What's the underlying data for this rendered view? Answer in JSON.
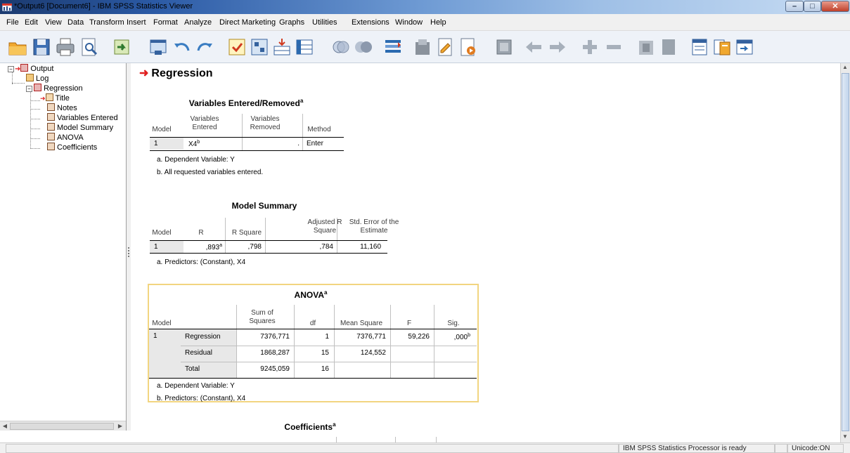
{
  "window": {
    "title": "*Output6 [Document6] - IBM SPSS Statistics Viewer"
  },
  "menu": [
    "File",
    "Edit",
    "View",
    "Data",
    "Transform",
    "Insert",
    "Format",
    "Analyze",
    "Direct Marketing",
    "Graphs",
    "Utilities",
    "Extensions",
    "Window",
    "Help"
  ],
  "toolbar_icons": [
    "open-icon",
    "save-icon",
    "print-icon",
    "print-preview-icon",
    "export-icon",
    "recall-dialog-icon",
    "undo-icon",
    "redo-icon",
    "goto-case-icon",
    "goto-variable-icon",
    "variables-icon",
    "insert-cases-icon",
    "value-labels-icon",
    "use-sets-icon",
    "split-file-icon",
    "select-cases-icon",
    "insert-output-icon",
    "insert-text-icon",
    "insert-title-icon",
    "designate-window-icon",
    "back-icon",
    "forward-icon",
    "expand-icon",
    "collapse-icon",
    "show-icon",
    "hide-icon",
    "insert-heading-icon",
    "insert-page-title-icon",
    "insert-new-text-icon"
  ],
  "outline": {
    "root": "Output",
    "log": "Log",
    "regression": "Regression",
    "items": [
      "Title",
      "Notes",
      "Variables Entered",
      "Model Summary",
      "ANOVA",
      "Coefficients"
    ]
  },
  "content": {
    "section_title": "Regression",
    "ver": {
      "title": "Variables Entered/Removed",
      "title_sup": "a",
      "headers": [
        "Model",
        "Variables Entered",
        "Variables Removed",
        "Method"
      ],
      "row": {
        "model": "1",
        "entered": "X4",
        "entered_sup": "b",
        "removed": ".",
        "method": "Enter"
      },
      "footnotes": [
        "a. Dependent Variable: Y",
        "b. All requested variables entered."
      ]
    },
    "model_summary": {
      "title": "Model Summary",
      "headers": [
        "Model",
        "R",
        "R Square",
        "Adjusted R Square",
        "Std. Error of the Estimate"
      ],
      "row": {
        "model": "1",
        "r": ",893",
        "r_sup": "a",
        "r_square": ",798",
        "adj_r_square": ",784",
        "std_error": "11,160"
      },
      "footnotes": [
        "a. Predictors: (Constant), X4"
      ]
    },
    "anova": {
      "title": "ANOVA",
      "title_sup": "a",
      "headers": [
        "Model",
        "Sum of Squares",
        "df",
        "Mean Square",
        "F",
        "Sig."
      ],
      "model": "1",
      "rows": [
        {
          "label": "Regression",
          "ss": "7376,771",
          "df": "1",
          "ms": "7376,771",
          "f": "59,226",
          "sig": ",000",
          "sig_sup": "b"
        },
        {
          "label": "Residual",
          "ss": "1868,287",
          "df": "15",
          "ms": "124,552",
          "f": "",
          "sig": ""
        },
        {
          "label": "Total",
          "ss": "9245,059",
          "df": "16",
          "ms": "",
          "f": "",
          "sig": ""
        }
      ],
      "footnotes": [
        "a. Dependent Variable: Y",
        "b. Predictors: (Constant), X4"
      ]
    },
    "coefficients": {
      "title": "Coefficients",
      "title_sup": "a"
    }
  },
  "status": {
    "processor": "IBM SPSS Statistics Processor is ready",
    "unicode": "Unicode:ON"
  },
  "colors": {
    "accent_red": "#e02020",
    "selection_border": "#f2d580"
  }
}
